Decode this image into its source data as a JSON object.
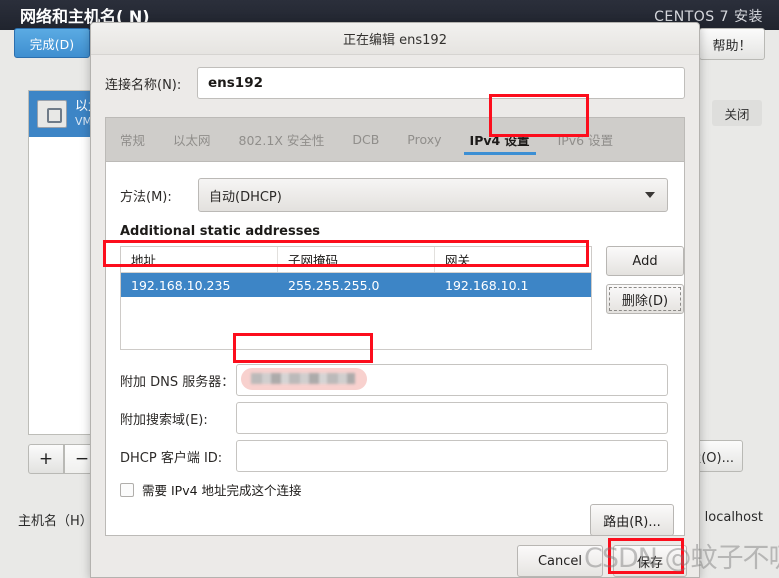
{
  "installer": {
    "title": "网络和主机名( N)",
    "brand": "CENTOS 7 安装",
    "done_label": "完成(D)",
    "help_label": "帮助！",
    "close_label": "关闭",
    "configure_label": "置(O)...",
    "add_device_label": "+",
    "remove_device_label": "−",
    "hostname_label": "主机名（H）",
    "hostname_value": "localhost",
    "device": {
      "name": "以太",
      "subtitle": "VMwa",
      "icon": "ethernet-icon"
    }
  },
  "dialog": {
    "title": "正在编辑 ens192",
    "connection_name_label": "连接名称(N):",
    "connection_name_value": "ens192",
    "tabs": [
      {
        "label": "常规",
        "active": false
      },
      {
        "label": "以太网",
        "active": false
      },
      {
        "label": "802.1X 安全性",
        "active": false
      },
      {
        "label": "DCB",
        "active": false
      },
      {
        "label": "Proxy",
        "active": false
      },
      {
        "label": "IPv4 设置",
        "active": true
      },
      {
        "label": "IPv6 设置",
        "active": false
      }
    ],
    "method": {
      "label": "方法(M):",
      "value": "自动(DHCP)",
      "arrow_icon": "chevron-down-icon"
    },
    "static_addresses": {
      "heading": "Additional static addresses",
      "columns": [
        "地址",
        "子网掩码",
        "网关"
      ],
      "rows": [
        [
          "192.168.10.235",
          "255.255.255.0",
          "192.168.10.1"
        ]
      ],
      "add_label": "Add",
      "delete_label": "删除(D)"
    },
    "fields": [
      {
        "label": "附加 DNS 服务器：",
        "value": "",
        "redacted": true
      },
      {
        "label": "附加搜索域(E):",
        "value": ""
      },
      {
        "label": "DHCP 客户端 ID:",
        "value": ""
      }
    ],
    "require_ipv4_label": "需要 IPv4 地址完成这个连接",
    "route_label": "路由(R)...",
    "cancel_label": "Cancel",
    "save_label": "保存"
  },
  "watermark": {
    "text": "CSDN @蚊子不吸吸"
  },
  "colors": {
    "accent_blue": "#3d85c6",
    "annotation_red": "#fc0d1c",
    "tab_underline": "#3c8fd4",
    "header_dark": "#20242e"
  }
}
